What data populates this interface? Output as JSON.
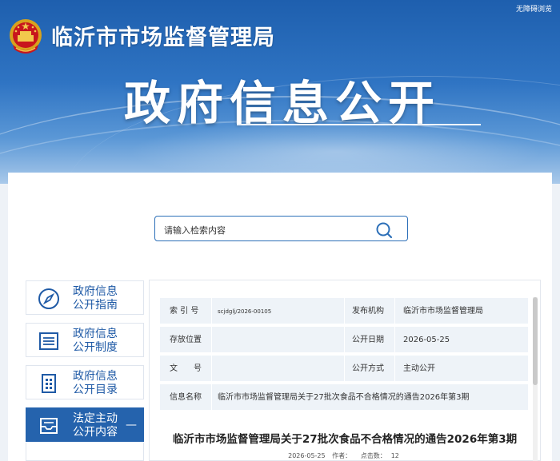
{
  "header": {
    "site_title": "临沂市市场监督管理局",
    "accessibility_link": "无障碍浏览",
    "hero_title": "政府信息公开",
    "emblem_icon": "national-emblem-icon"
  },
  "search": {
    "placeholder": "请输入检索内容",
    "icon": "search-icon"
  },
  "sidebar": {
    "items": [
      {
        "label_line1": "政府信息",
        "label_line2": "公开指南",
        "icon": "compass-icon",
        "active": false
      },
      {
        "label_line1": "政府信息",
        "label_line2": "公开制度",
        "icon": "list-icon",
        "active": false
      },
      {
        "label_line1": "政府信息",
        "label_line2": "公开目录",
        "icon": "grid-icon",
        "active": false
      },
      {
        "label_line1": "法定主动",
        "label_line2": "公开内容",
        "icon": "inbox-icon",
        "active": true,
        "toggle": "—"
      }
    ]
  },
  "meta": {
    "index_label": "索 引 号",
    "index_value": "scjdglj/2026-00105",
    "publisher_label": "发布机构",
    "publisher_value": "临沂市市场监督管理局",
    "location_label": "存放位置",
    "location_value": "",
    "date_label": "公开日期",
    "date_value": "2026-05-25",
    "docno_label": "文　　号",
    "docno_value": "",
    "method_label": "公开方式",
    "method_value": "主动公开",
    "name_label": "信息名称",
    "name_value": "临沂市市场监督管理局关于27批次食品不合格情况的通告2026年第3期"
  },
  "document": {
    "title": "临沂市市场监督管理局关于27批次食品不合格情况的通告2026年第3期",
    "date": "2026-05-25",
    "author_label": "作者：",
    "clicks_label": "点击数：",
    "clicks_value": "12"
  },
  "colors": {
    "brand_blue": "#2563ad",
    "link_blue": "#1f5aa6",
    "meta_bg": "#eef3f8"
  }
}
